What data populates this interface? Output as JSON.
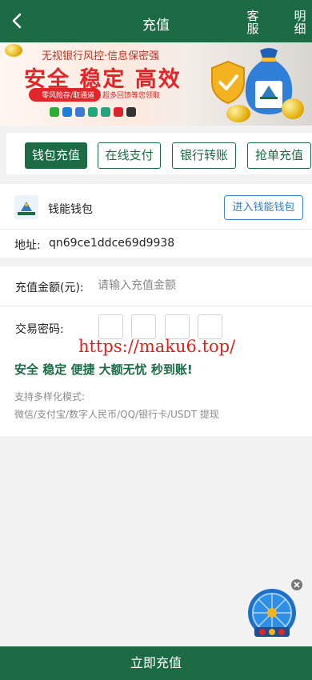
{
  "header": {
    "title": "充值",
    "customer_service": "客服",
    "details": "明细"
  },
  "banner": {
    "line1": "无视银行风控·信息保密强",
    "headline": "安全 稳定 高效",
    "pill": "零风险存/取通道",
    "note": "超多回馈等您领取",
    "bag_label": "钱能钱包"
  },
  "tabs": [
    {
      "label": "钱包充值",
      "active": true
    },
    {
      "label": "在线支付",
      "active": false
    },
    {
      "label": "银行转账",
      "active": false
    },
    {
      "label": "抢单充值",
      "active": false
    }
  ],
  "wallet": {
    "name": "钱能钱包",
    "enter_button": "进入钱能钱包",
    "address_label": "地址:",
    "address_value": "qn69ce1ddce69d9938"
  },
  "form": {
    "amount_label": "充值金额(元):",
    "amount_placeholder": "请输入充值金额",
    "amount_value": "",
    "password_label": "交易密码:",
    "password_digits": 4
  },
  "watermark_url": "https://maku6.top/",
  "slogan": "安全 稳定 便捷 大额无忧 秒到账!",
  "support": {
    "title": "支持多样化模式:",
    "methods": "微信/支付宝/数字人民币/QQ/银行卡/USDT 提现"
  },
  "submit_button": "立即充值",
  "colors": {
    "primary": "#1d6b45",
    "link_blue": "#2f7cc0",
    "watermark_red": "#e0201c",
    "banner_red": "#e1262a"
  }
}
